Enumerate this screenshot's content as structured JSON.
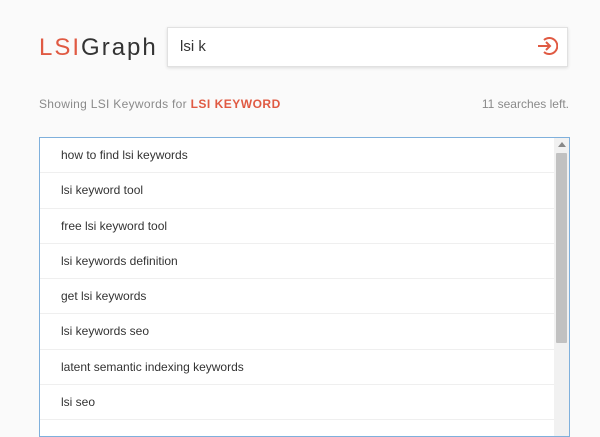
{
  "logo": {
    "part1": "LSI",
    "part2": "Graph"
  },
  "search": {
    "value": "lsi k",
    "placeholder": ""
  },
  "status": {
    "prefix": "Showing LSI Keywords for",
    "keyword": "LSI KEYWORD"
  },
  "remaining_searches": "11 searches left.",
  "results": [
    "how to find lsi keywords",
    "lsi keyword tool",
    "free lsi keyword tool",
    "lsi keywords definition",
    "get lsi keywords",
    "lsi keywords seo",
    "latent semantic indexing keywords",
    "lsi seo"
  ],
  "colors": {
    "accent": "#e05a43",
    "border_focus": "#7fb0dc",
    "muted_text": "#8a8a8a"
  },
  "icons": {
    "submit": "login-arrow-icon"
  }
}
